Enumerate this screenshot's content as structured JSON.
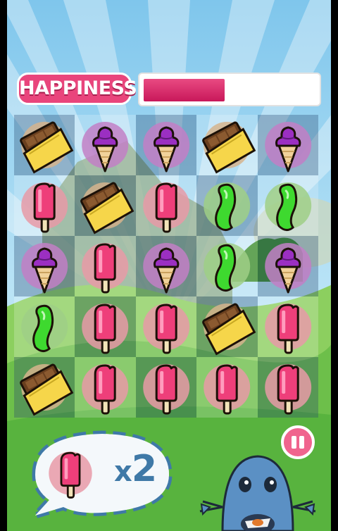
{
  "header": {
    "happiness_label": "HAPPINESS",
    "happiness_level_percent": 47,
    "bar_color": "#d42a68"
  },
  "board": {
    "rows": 5,
    "cols": 5,
    "cells": [
      [
        "chocolate",
        "icecream",
        "icecream",
        "chocolate",
        "icecream"
      ],
      [
        "popsicle",
        "chocolate",
        "popsicle",
        "jellybean",
        "jellybean"
      ],
      [
        "icecream",
        "popsicle",
        "icecream",
        "jellybean",
        "icecream"
      ],
      [
        "jellybean",
        "popsicle",
        "popsicle",
        "chocolate",
        "popsicle"
      ],
      [
        "chocolate",
        "popsicle",
        "popsicle",
        "popsicle",
        "popsicle"
      ]
    ]
  },
  "goal": {
    "item": "popsicle",
    "multiplier_symbol": "x",
    "count": "2"
  },
  "icons": {
    "pause": "pause-icon",
    "chocolate": "chocolate-bar-icon",
    "icecream": "ice-cream-cone-icon",
    "popsicle": "popsicle-icon",
    "jellybean": "jelly-bean-icon"
  },
  "colors": {
    "accent_pink": "#e9457c",
    "goal_blue": "#3f79a7",
    "sky_blue": "#9fd3ef",
    "grass_green": "#5fb54a"
  }
}
